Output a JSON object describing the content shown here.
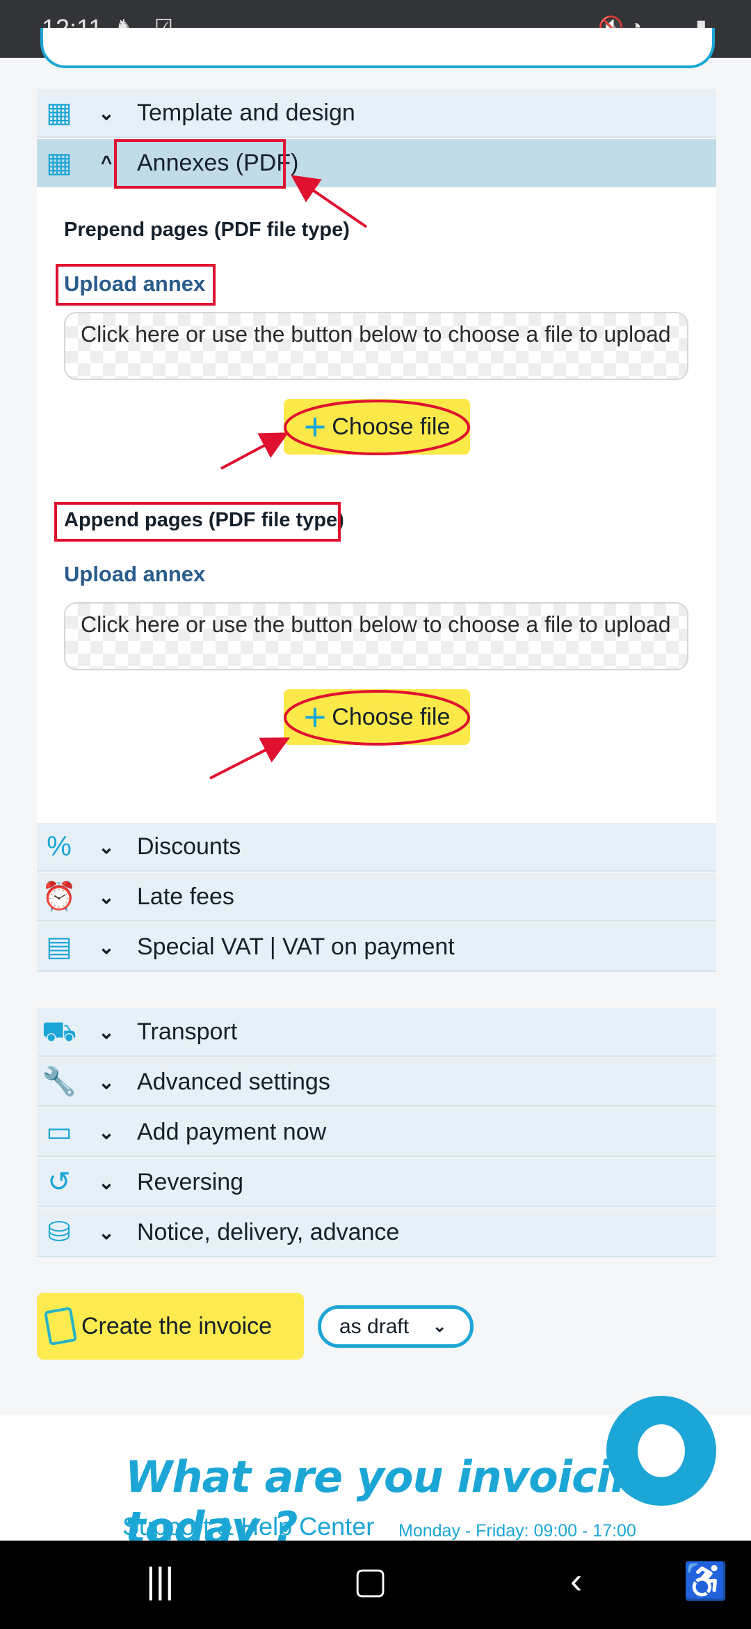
{
  "status_bar": {
    "time": "12:11"
  },
  "sections_top": [
    {
      "label": "Template and design",
      "icon": "invoice-template-icon",
      "expanded": false
    },
    {
      "label": "Annexes (PDF)",
      "icon": "invoice-template-icon",
      "expanded": true
    }
  ],
  "annexes": {
    "prepend_title": "Prepend pages (PDF file type)",
    "prepend_upload_label": "Upload annex",
    "prepend_drop_text": "Click here or use the button below to choose a file to upload",
    "prepend_button": "Choose file",
    "append_title": "Append pages (PDF file type)",
    "append_upload_label": "Upload annex",
    "append_drop_text": "Click here or use the button below to choose a file to upload",
    "append_button": "Choose file"
  },
  "sections_mid": [
    {
      "label": "Discounts",
      "icon": "percent-icon"
    },
    {
      "label": "Late fees",
      "icon": "alarm-clock-icon"
    },
    {
      "label": "Special VAT | VAT on payment",
      "icon": "calculator-icon"
    }
  ],
  "sections_bottom": [
    {
      "label": "Transport",
      "icon": "truck-icon"
    },
    {
      "label": "Advanced settings",
      "icon": "wrench-icon"
    },
    {
      "label": "Add payment now",
      "icon": "payment-card-icon"
    },
    {
      "label": "Reversing",
      "icon": "reverse-arrow-icon"
    },
    {
      "label": "Notice, delivery, advance",
      "icon": "hand-truck-icon"
    }
  ],
  "actions": {
    "create_label": "Create the invoice",
    "mode_value": "as draft"
  },
  "footer": {
    "headline": "What are you invoicing today ?",
    "support": "Support & Help Center",
    "hours": "Monday - Friday: 09:00 - 17:00"
  },
  "colors": {
    "accent": "#1ba6d6",
    "button_yellow": "#fdeb4f",
    "annotation_red": "#e0102f"
  }
}
